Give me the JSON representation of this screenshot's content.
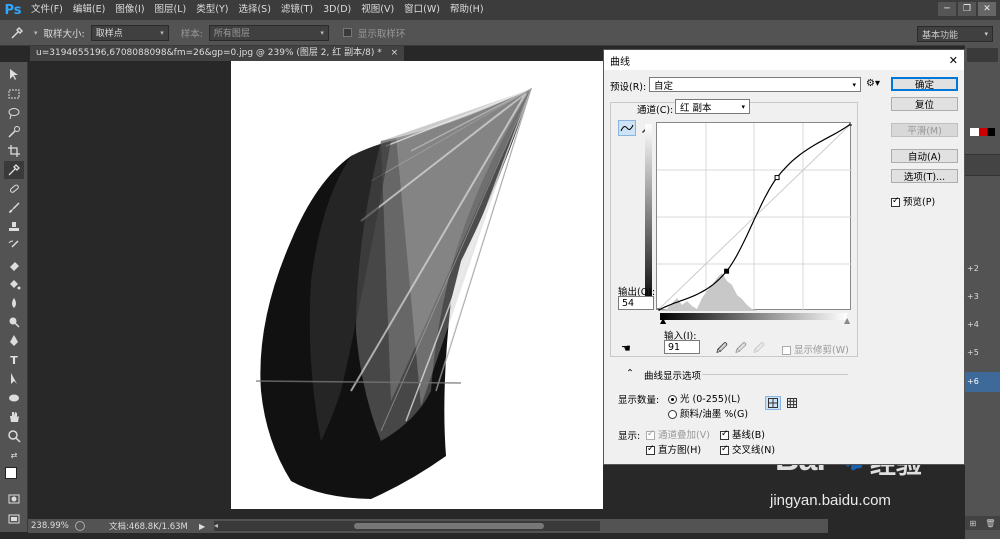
{
  "app": {
    "logo": "Ps"
  },
  "menu": [
    "文件(F)",
    "编辑(E)",
    "图像(I)",
    "图层(L)",
    "类型(Y)",
    "选择(S)",
    "滤镜(T)",
    "3D(D)",
    "视图(V)",
    "窗口(W)",
    "帮助(H)"
  ],
  "window_controls": [
    "─",
    "❐",
    "✕"
  ],
  "options": {
    "sample_size_label": "取样大小:",
    "sample_size_value": "取样点",
    "sample_label": "样本:",
    "sample_value": "所有图层",
    "show_ring_label": "显示取样环",
    "workspace": "基本功能"
  },
  "document": {
    "tab_title": "u=3194655196,6708088098&fm=26&gp=0.jpg @ 239% (图层 2, 红 副本/8) *",
    "close": "×"
  },
  "status": {
    "zoom": "238.99%",
    "doc_info": "文档:468.8K/1.63M"
  },
  "right_panel_labels": [
    "+2",
    "+3",
    "+4",
    "+5",
    "+6"
  ],
  "watermark": {
    "brand_left": "Bai",
    "brand_right": "经验",
    "url": "jingyan.baidu.com"
  },
  "dialog": {
    "title": "曲线",
    "close": "✕",
    "preset_label": "预设(R):",
    "preset_value": "自定",
    "channel_label": "通道(C):",
    "channel_value": "红 副本",
    "output_label": "输出(O):",
    "output_value": "54",
    "input_label": "输入(I):",
    "input_value": "91",
    "show_clipping_label": "显示修剪(W)",
    "curve_options_label": "曲线显示选项",
    "show_amount_label": "显示数量:",
    "light_label": "光 (0-255)(L)",
    "pigment_label": "颜料/油墨 %(G)",
    "show_label": "显示:",
    "channel_overlay_label": "通道叠加(V)",
    "baseline_label": "基线(B)",
    "histogram_label": "直方图(H)",
    "intersection_label": "交叉线(N)",
    "buttons": {
      "ok": "确定",
      "reset": "复位",
      "smooth": "平滑(M)",
      "auto": "自动(A)",
      "options": "选项(T)..."
    },
    "preview_label": "预览(P)",
    "checks": {
      "show_clipping": false,
      "channel_overlay": true,
      "baseline": true,
      "histogram": true,
      "intersection": true,
      "preview": true
    },
    "light_selected": true,
    "curve": {
      "points": [
        [
          0,
          0
        ],
        [
          91,
          54
        ],
        [
          157,
          181
        ],
        [
          255,
          255
        ]
      ],
      "input_range": [
        0,
        255
      ],
      "output_range": [
        0,
        255
      ],
      "selected_point": [
        91,
        54
      ]
    }
  }
}
